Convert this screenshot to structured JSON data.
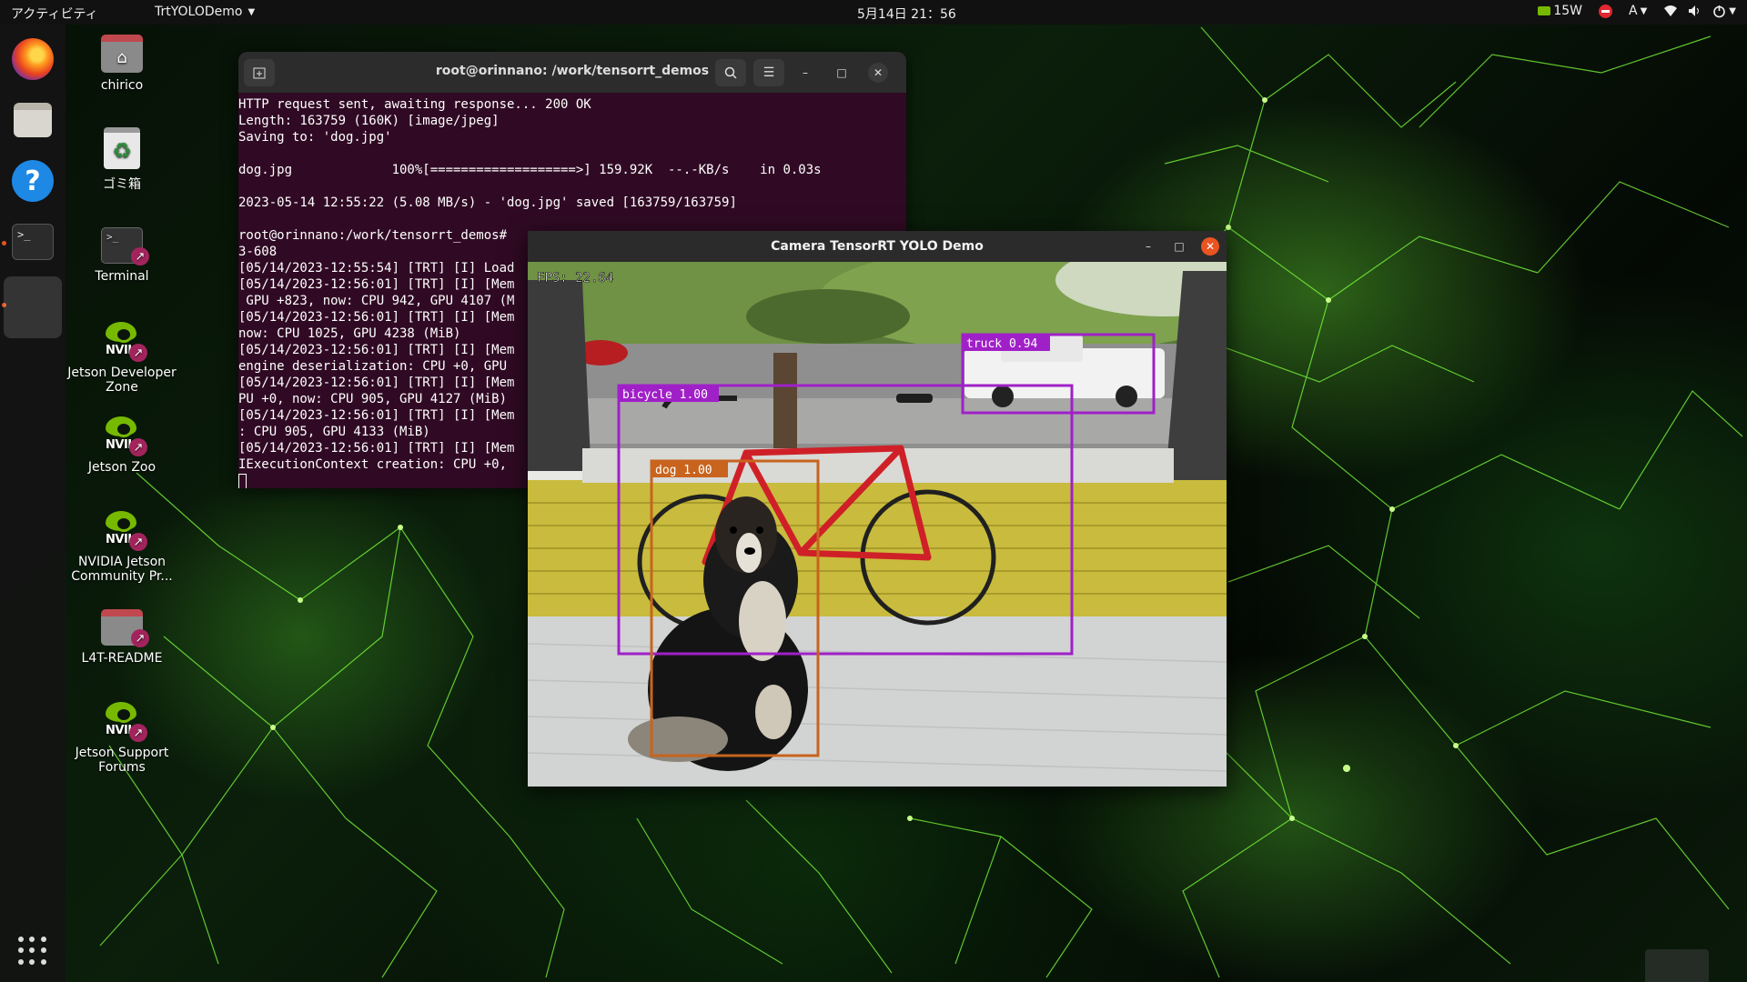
{
  "topbar": {
    "activities": "アクティビティ",
    "app_name": "TrtYOLODemo",
    "clock": "5月14日  21：56",
    "power": "15W",
    "input_method": "A"
  },
  "desktop_icons": [
    {
      "label": "chirico"
    },
    {
      "label": "ゴミ箱"
    },
    {
      "label": "Terminal"
    },
    {
      "label": "Jetson Developer Zone"
    },
    {
      "label": "Jetson Zoo"
    },
    {
      "label": "NVIDIA Jetson Community Pr..."
    },
    {
      "label": "L4T-README"
    },
    {
      "label": "Jetson Support Forums"
    }
  ],
  "terminal": {
    "title": "root@orinnano: /work/tensorrt_demos",
    "lines": [
      "HTTP request sent, awaiting response... 200 OK",
      "Length: 163759 (160K) [image/jpeg]",
      "Saving to: 'dog.jpg'",
      "",
      "dog.jpg             100%[===================>] 159.92K  --.-KB/s    in 0.03s",
      "",
      "2023-05-14 12:55:22 (5.08 MB/s) - 'dog.jpg' saved [163759/163759]",
      "",
      "root@orinnano:/work/tensorrt_demos#",
      "3-608",
      "[05/14/2023-12:55:54] [TRT] [I] Load",
      "[05/14/2023-12:56:01] [TRT] [I] [Mem",
      " GPU +823, now: CPU 942, GPU 4107 (M",
      "[05/14/2023-12:56:01] [TRT] [I] [Mem",
      "now: CPU 1025, GPU 4238 (MiB)",
      "[05/14/2023-12:56:01] [TRT] [I] [Mem",
      "engine deserialization: CPU +0, GPU",
      "[05/14/2023-12:56:01] [TRT] [I] [Mem",
      "PU +0, now: CPU 905, GPU 4127 (MiB)",
      "[05/14/2023-12:56:01] [TRT] [I] [Mem",
      ": CPU 905, GPU 4133 (MiB)",
      "[05/14/2023-12:56:01] [TRT] [I] [Mem",
      "IExecutionContext creation: CPU +0,"
    ]
  },
  "camera": {
    "title": "Camera TensorRT YOLO Demo",
    "fps": "FPS: 22.64",
    "detections": [
      {
        "label": "truck 0.94",
        "color": "#a020c8"
      },
      {
        "label": "bicycle 1.00",
        "color": "#a020c8"
      },
      {
        "label": "dog 1.00",
        "color": "#c8641e"
      }
    ]
  }
}
